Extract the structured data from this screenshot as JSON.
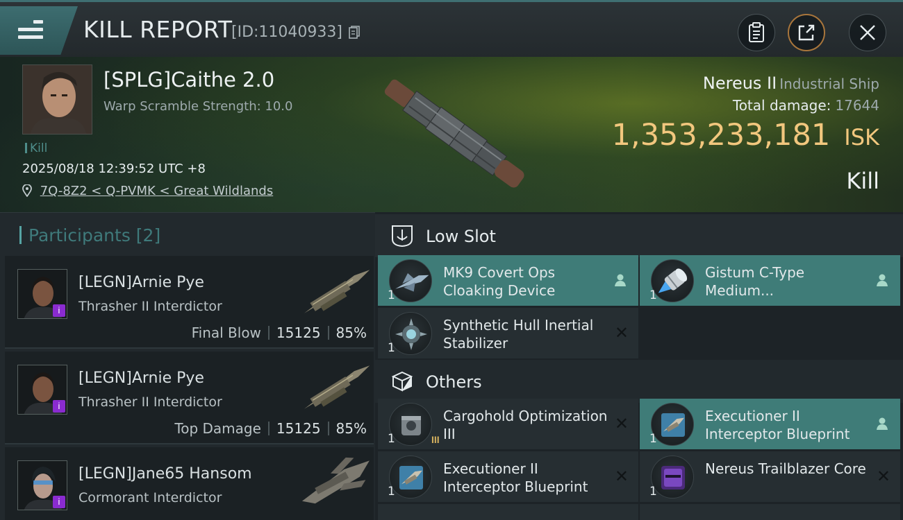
{
  "header": {
    "title": "KILL REPORT",
    "report_id": "[ID:11040933]"
  },
  "victim": {
    "name": "[SPLG]Caithe 2.0",
    "subtitle": "Warp Scramble Strength: 10.0",
    "tag": "Kill",
    "datetime": "2025/08/18 12:39:52 UTC +8",
    "location": "7Q-8Z2 < Q-PVMK < Great Wildlands",
    "ship_name": "Nereus II",
    "ship_class": "Industrial Ship",
    "total_damage_label": "Total damage:",
    "total_damage": "17644",
    "isk_value": "1,353,233,181",
    "isk_unit": "ISK",
    "result": "Kill"
  },
  "participants": {
    "title": "Participants [2]",
    "list": [
      {
        "name": "[LEGN]Arnie Pye",
        "ship": "Thrasher II Interdictor",
        "role": "Final Blow",
        "damage": "15125",
        "percent": "85%"
      },
      {
        "name": "[LEGN]Arnie Pye",
        "ship": "Thrasher II Interdictor",
        "role": "Top Damage",
        "damage": "15125",
        "percent": "85%"
      },
      {
        "name": "[LEGN]Jane65 Hansom",
        "ship": "Cormorant Interdictor",
        "role": "",
        "damage": "",
        "percent": ""
      }
    ]
  },
  "sections": {
    "low_slot": "Low Slot",
    "others": "Others"
  },
  "items": [
    {
      "name": "MK9 Covert Ops Cloaking Device",
      "qty": "1",
      "status": "dropped"
    },
    {
      "name": "Gistum C-Type Medium...",
      "qty": "1",
      "status": "dropped"
    },
    {
      "name": "Synthetic Hull Inertial Stabilizer",
      "qty": "1",
      "status": "destroyed"
    },
    {
      "name": "Cargohold Optimization III",
      "qty": "1",
      "status": "destroyed",
      "tier": "III"
    },
    {
      "name": "Executioner II Interceptor Blueprint",
      "qty": "1",
      "status": "dropped"
    },
    {
      "name": "Executioner II Interceptor Blueprint",
      "qty": "1",
      "status": "destroyed"
    },
    {
      "name": "Nereus Trailblazer Core",
      "qty": "1",
      "status": "destroyed"
    }
  ],
  "colors": {
    "accent": "#3f7c78",
    "isk": "#f2c77e",
    "rarity_purple": "#8a2bd0"
  },
  "icons": {
    "menu": "hamburger-icon",
    "copy": "copy-icon",
    "clipboard": "clipboard-icon",
    "share": "share-icon",
    "close": "close-icon",
    "location": "map-pin-icon",
    "low_slot": "low-slot-icon",
    "others": "cube-icon",
    "dropped": "person-icon",
    "destroyed": "x-icon"
  }
}
